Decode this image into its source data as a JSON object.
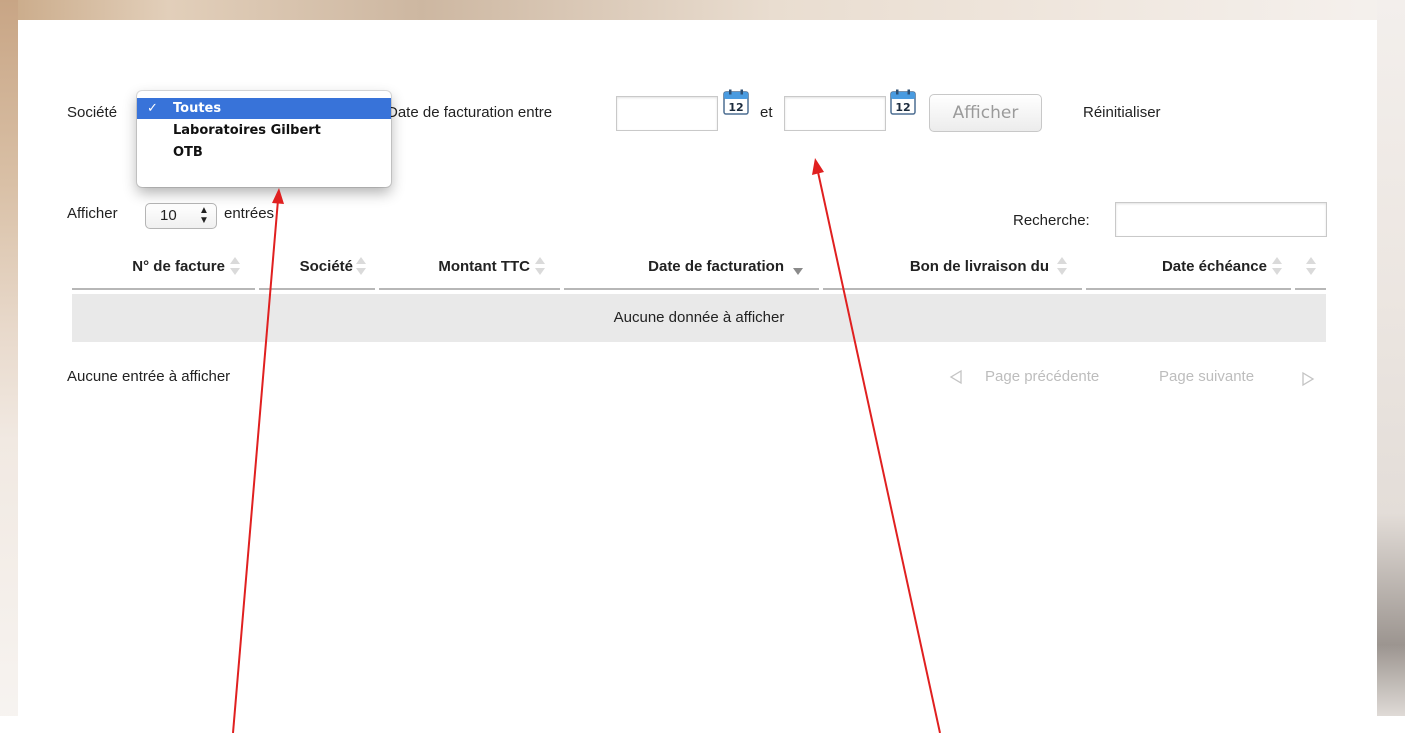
{
  "filters": {
    "societe_label": "Société",
    "date_label": "Date de facturation entre",
    "et_label": "et",
    "date_from_value": "",
    "date_to_value": "",
    "calendar_day": "12",
    "afficher_button": "Afficher",
    "reset_link": "Réinitialiser"
  },
  "dropdown": {
    "selected_mark": "✓",
    "options": [
      "Toutes",
      "Laboratoires Gilbert",
      "OTB"
    ],
    "selected": "Toutes"
  },
  "table_controls": {
    "show_label": "Afficher",
    "length_value": "10",
    "entries_label": "entrées",
    "search_label": "Recherche:",
    "search_value": ""
  },
  "table": {
    "columns": [
      "N° de facture",
      "Société",
      "Montant TTC",
      "Date de facturation",
      "Bon de livraison du",
      "Date échéance"
    ],
    "sorted_column": "Date de facturation",
    "empty_message": "Aucune donnée à afficher"
  },
  "footer": {
    "info": "Aucune entrée à afficher",
    "prev": "Page précédente",
    "next": "Page suivante"
  },
  "colors": {
    "selection_blue": "#3873d9",
    "annotation_arrow": "#e02020",
    "row_empty_bg": "#e9e9e9"
  }
}
